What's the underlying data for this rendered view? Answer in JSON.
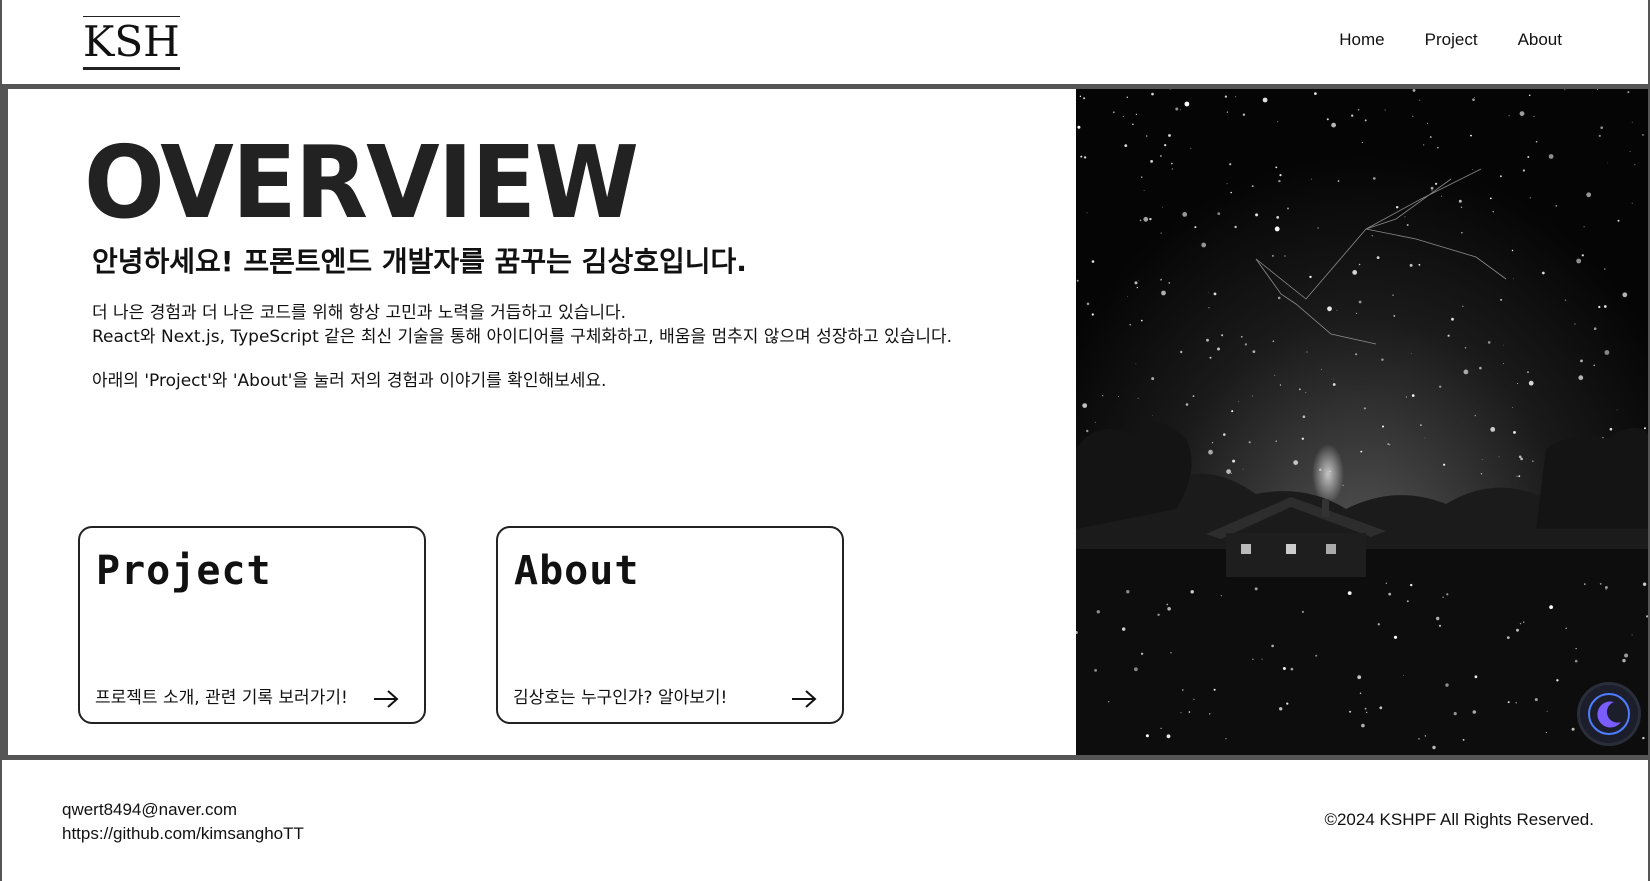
{
  "header": {
    "logo": "KSH",
    "nav": [
      "Home",
      "Project",
      "About"
    ]
  },
  "hero": {
    "title": "OVERVIEW",
    "greeting": "안녕하세요! 프론트엔드 개발자를 꿈꾸는 김상호입니다.",
    "paragraph_1": "더 나은 경험과 더 나은 코드를 위해 항상 고민과 노력을 거듭하고 있습니다.",
    "paragraph_2": "React와 Next.js, TypeScript 같은 최신 기술을 통해 아이디어를 구체화하고, 배움을 멈추지 않으며 성장하고 있습니다.",
    "paragraph_3": "아래의 'Project'와 'About'을 눌러 저의 경험과 이야기를 확인해보세요."
  },
  "cards": [
    {
      "title": "Project",
      "subtitle": "프로젝트 소개, 관련 기록 보러가기!"
    },
    {
      "title": "About",
      "subtitle": "김상호는 누구인가? 알아보기!"
    }
  ],
  "image": {
    "description_icon": "night-sky-cabin-image"
  },
  "theme_toggle": {
    "icon": "moon-icon",
    "accent": "#7a5cff"
  },
  "footer": {
    "email": "qwert8494@naver.com",
    "github": "https://github.com/kimsanghoTT",
    "copyright": "©2024 KSHPF All Rights Reserved."
  }
}
